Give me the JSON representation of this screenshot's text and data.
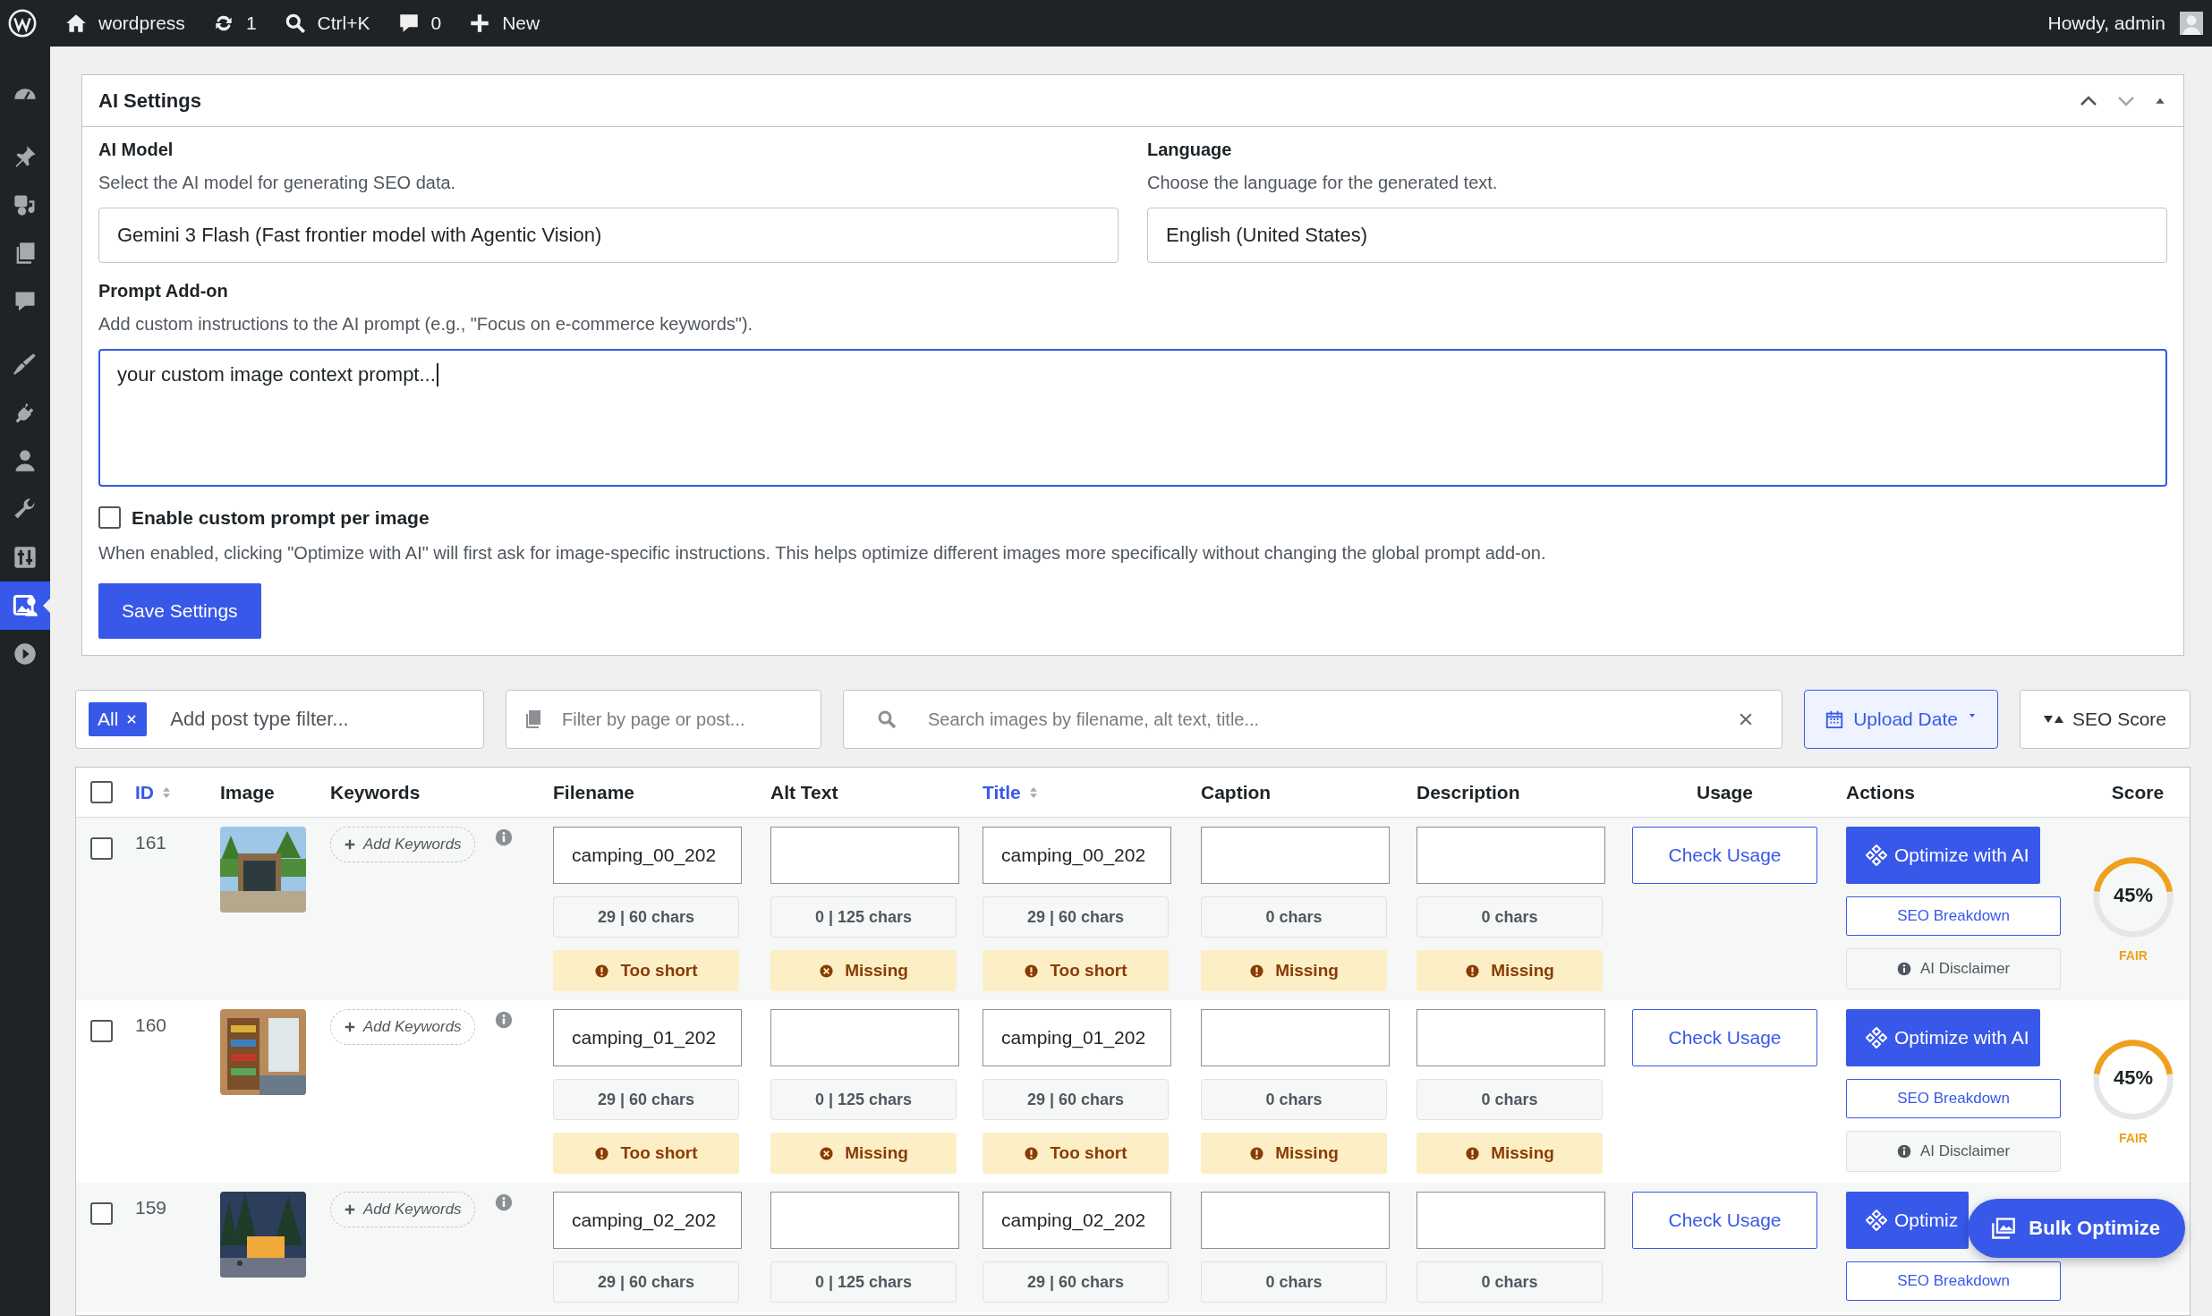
{
  "admin_bar": {
    "items": [
      {
        "kind": "logo"
      },
      {
        "kind": "home",
        "label": "wordpress"
      },
      {
        "kind": "updates",
        "label": "1"
      },
      {
        "kind": "search",
        "label": "Ctrl+K"
      },
      {
        "kind": "comments",
        "label": "0"
      },
      {
        "kind": "new",
        "label": "New"
      }
    ],
    "greeting": "Howdy, admin"
  },
  "sidebar": {
    "items": [
      {
        "kind": "dashboard",
        "selected": false
      },
      {
        "kind": "pin",
        "selected": false
      },
      {
        "kind": "media",
        "selected": false
      },
      {
        "kind": "pages",
        "selected": false
      },
      {
        "kind": "comments",
        "selected": false
      },
      {
        "kind": "brush",
        "selected": false
      },
      {
        "kind": "plug",
        "selected": false
      },
      {
        "kind": "user",
        "selected": false
      },
      {
        "kind": "wrench",
        "selected": false
      },
      {
        "kind": "settings",
        "selected": false
      },
      {
        "kind": "image-user",
        "selected": true
      },
      {
        "kind": "play",
        "selected": false
      }
    ]
  },
  "settings": {
    "title": "AI Settings",
    "model": {
      "label": "AI Model",
      "description": "Select the AI model for generating SEO data.",
      "value": "Gemini 3 Flash (Fast frontier model with Agentic Vision)"
    },
    "language": {
      "label": "Language",
      "description": "Choose the language for the generated text.",
      "value": "English (United States)"
    },
    "prompt": {
      "label": "Prompt Add-on",
      "description": "Add custom instructions to the AI prompt (e.g., \"Focus on e-commerce keywords\").",
      "value": "your custom image context prompt..."
    },
    "custom_prompt": {
      "label": "Enable custom prompt per image",
      "checked": false
    },
    "note": "When enabled, clicking \"Optimize with AI\" will first ask for image-specific instructions. This helps optimize different images more specifically without changing the global prompt add-on.",
    "save_button": "Save Settings"
  },
  "filters": {
    "post_type": {
      "tags": [
        "All"
      ],
      "placeholder": "Add post type filter..."
    },
    "page": {
      "placeholder": "Filter by page or post..."
    },
    "search": {
      "placeholder": "Search images by filename, alt text, title..."
    },
    "upload_date": "Upload Date",
    "seo_score": "SEO Score"
  },
  "table": {
    "select_all": false,
    "columns": [
      {
        "label": "ID",
        "sortable": true
      },
      {
        "label": "Image",
        "sortable": false
      },
      {
        "label": "Keywords",
        "sortable": false
      },
      {
        "label": "Filename",
        "sortable": false
      },
      {
        "label": "Alt Text",
        "sortable": false
      },
      {
        "label": "Title",
        "sortable": true
      },
      {
        "label": "Caption",
        "sortable": false
      },
      {
        "label": "Description",
        "sortable": false
      },
      {
        "label": "Usage",
        "sortable": false
      },
      {
        "label": "Actions",
        "sortable": false
      },
      {
        "label": "Score",
        "sortable": false
      }
    ],
    "rows": [
      {
        "selected": false,
        "id": "161",
        "keywords_button": "Add Keywords",
        "fields": [
          {
            "value": "camping_00_202",
            "count": "29 | 60 chars",
            "status": {
              "kind": "warning",
              "label": "Too short"
            }
          },
          {
            "count": "0 | 125 chars",
            "status": {
              "kind": "error",
              "label": "Missing"
            }
          },
          {
            "value": "camping_00_202",
            "count": "29 | 60 chars",
            "status": {
              "kind": "warning",
              "label": "Too short"
            }
          },
          {
            "count": "0 chars",
            "status": {
              "kind": "warning",
              "label": "Missing"
            }
          },
          {
            "count": "0 chars",
            "status": {
              "kind": "warning",
              "label": "Missing"
            }
          }
        ],
        "usage_button": "Check Usage",
        "optimize_button": "Optimize with AI",
        "seo_breakdown": "SEO Breakdown",
        "disclaimer": "AI Disclaimer",
        "score": {
          "value": "45%",
          "level": 0.45,
          "rating": "FAIR"
        }
      },
      {
        "selected": false,
        "id": "160",
        "keywords_button": "Add Keywords",
        "fields": [
          {
            "value": "camping_01_202",
            "count": "29 | 60 chars",
            "status": {
              "kind": "warning",
              "label": "Too short"
            }
          },
          {
            "count": "0 | 125 chars",
            "status": {
              "kind": "error",
              "label": "Missing"
            }
          },
          {
            "value": "camping_01_202",
            "count": "29 | 60 chars",
            "status": {
              "kind": "warning",
              "label": "Too short"
            }
          },
          {
            "count": "0 chars",
            "status": {
              "kind": "warning",
              "label": "Missing"
            }
          },
          {
            "count": "0 chars",
            "status": {
              "kind": "warning",
              "label": "Missing"
            }
          }
        ],
        "usage_button": "Check Usage",
        "optimize_button": "Optimize with AI",
        "seo_breakdown": "SEO Breakdown",
        "disclaimer": "AI Disclaimer",
        "score": {
          "value": "45%",
          "level": 0.45,
          "rating": "FAIR"
        }
      },
      {
        "selected": false,
        "id": "159",
        "keywords_button": "Add Keywords",
        "fields": [
          {
            "value": "camping_02_202",
            "count": "29 | 60 chars"
          },
          {
            "count": "0 | 125 chars"
          },
          {
            "value": "camping_02_202",
            "count": "29 | 60 chars"
          },
          {
            "count": "0 chars"
          },
          {
            "count": "0 chars"
          }
        ],
        "usage_button": "Check Usage",
        "optimize_button": "Optimiz",
        "seo_breakdown": "SEO Breakdown"
      }
    ]
  },
  "bulk_button": "Bulk Optimize"
}
